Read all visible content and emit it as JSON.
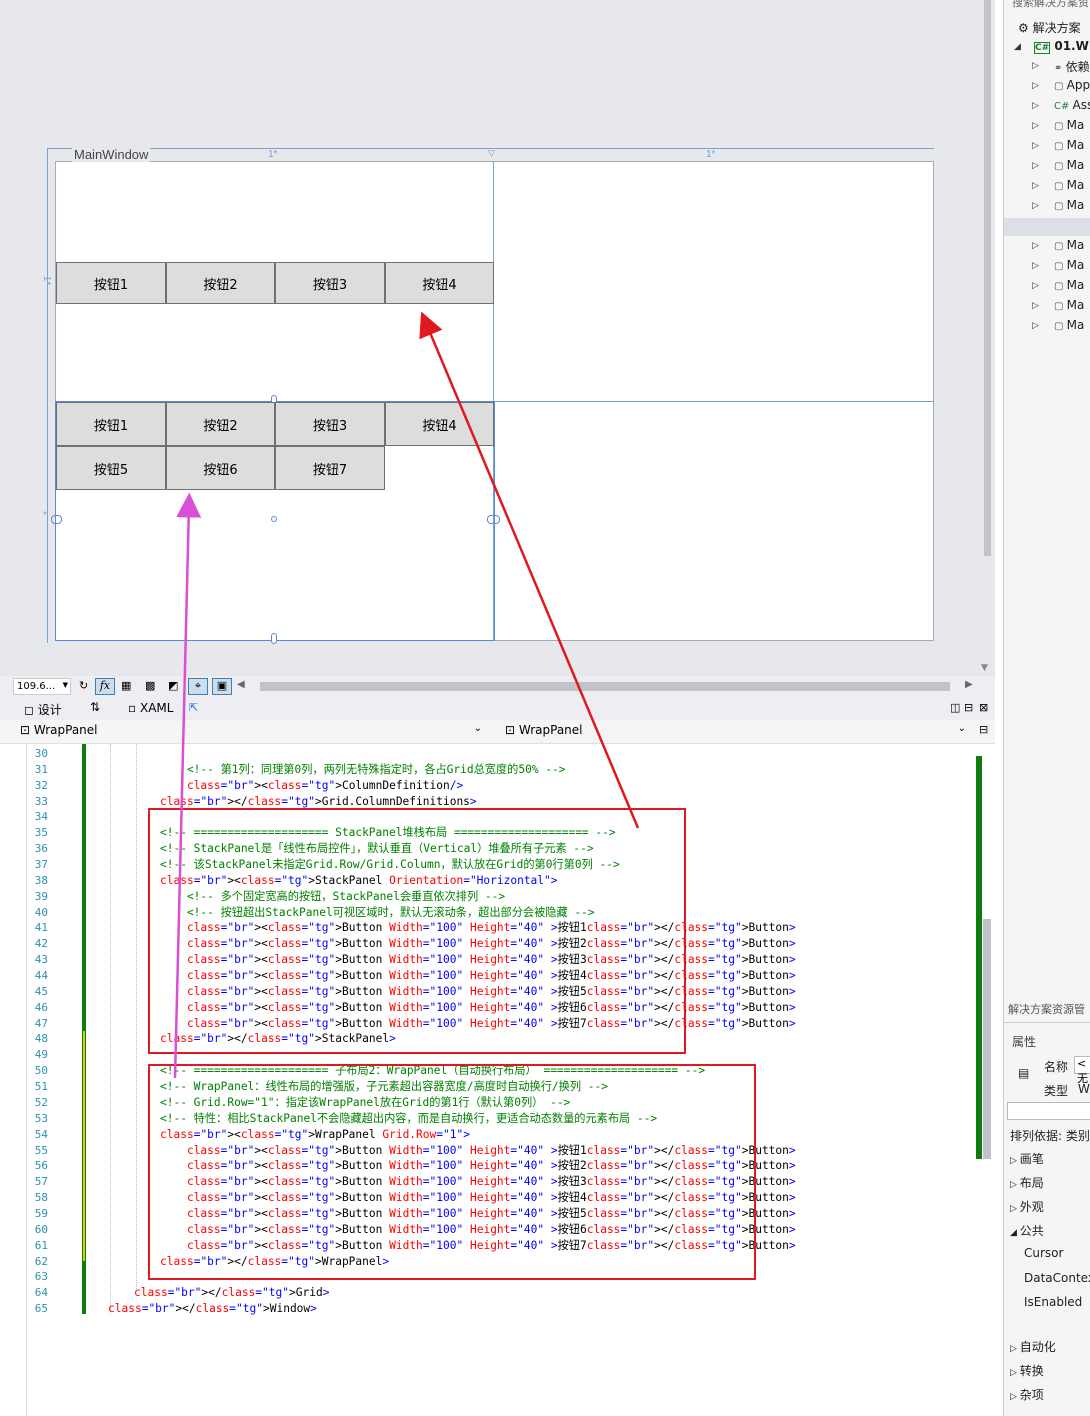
{
  "designer": {
    "window_title": "MainWindow",
    "col_header_1": "1*",
    "col_header_2": "1*",
    "row_header": "1*",
    "row_header_2": "*",
    "stack_buttons": [
      "按钮1",
      "按钮2",
      "按钮3",
      "按钮4"
    ],
    "wrap_buttons": [
      "按钮1",
      "按钮2",
      "按钮3",
      "按钮4",
      "按钮5",
      "按钮6",
      "按钮7"
    ]
  },
  "toolbar": {
    "zoom": "109.6...",
    "fx": "fx"
  },
  "tabs": {
    "design": "设计",
    "swap": "⇅",
    "xaml": "XAML"
  },
  "pathbar": {
    "left": "WrapPanel",
    "right": "WrapPanel"
  },
  "code": {
    "line_numbers": [
      "30",
      "31",
      "32",
      "33",
      "34",
      "35",
      "36",
      "37",
      "38",
      "39",
      "40",
      "41",
      "42",
      "43",
      "44",
      "45",
      "46",
      "47",
      "48",
      "49",
      "50",
      "51",
      "52",
      "53",
      "54",
      "55",
      "56",
      "57",
      "58",
      "59",
      "60",
      "61",
      "62",
      "63",
      "64",
      "65"
    ],
    "lines": [
      "",
      "    <!-- 第1列：同理第0列，两列无特殊指定时，各占Grid总宽度的50% -->",
      "    <ColumnDefinition/>",
      "</Grid.ColumnDefinitions>",
      "",
      "<!-- ==================== StackPanel堆栈布局 ==================== -->",
      "<!-- StackPanel是「线性布局控件」，默认垂直（Vertical）堆叠所有子元素 -->",
      "<!-- 该StackPanel未指定Grid.Row/Grid.Column，默认放在Grid的第0行第0列 -->",
      "<StackPanel Orientation=\"Horizontal\">",
      "    <!-- 多个固定宽高的按钮，StackPanel会垂直依次排列 -->",
      "    <!-- 按钮超出StackPanel可视区域时，默认无滚动条，超出部分会被隐藏 -->",
      "    <Button Width=\"100\" Height=\"40\" >按钮1</Button>",
      "    <Button Width=\"100\" Height=\"40\" >按钮2</Button>",
      "    <Button Width=\"100\" Height=\"40\" >按钮3</Button>",
      "    <Button Width=\"100\" Height=\"40\" >按钮4</Button>",
      "    <Button Width=\"100\" Height=\"40\" >按钮5</Button>",
      "    <Button Width=\"100\" Height=\"40\" >按钮6</Button>",
      "    <Button Width=\"100\" Height=\"40\" >按钮7</Button>",
      "</StackPanel>",
      "",
      "<!-- ==================== 子布局2：WrapPanel（自动换行布局） ==================== -->",
      "<!-- WrapPanel：线性布局的增强版，子元素超出容器宽度/高度时自动换行/换列 -->",
      "<!-- Grid.Row=\"1\"：指定该WrapPanel放在Grid的第1行（默认第0列） -->",
      "<!-- 特性：相比StackPanel不会隐藏超出内容，而是自动换行，更适合动态数量的元素布局 -->",
      "<WrapPanel Grid.Row=\"1\">",
      "    <Button Width=\"100\" Height=\"40\" >按钮1</Button>",
      "    <Button Width=\"100\" Height=\"40\" >按钮2</Button>",
      "    <Button Width=\"100\" Height=\"40\" >按钮3</Button>",
      "    <Button Width=\"100\" Height=\"40\" >按钮4</Button>",
      "    <Button Width=\"100\" Height=\"40\" >按钮5</Button>",
      "    <Button Width=\"100\" Height=\"40\" >按钮6</Button>",
      "    <Button Width=\"100\" Height=\"40\" >按钮7</Button>",
      "</WrapPanel>",
      "",
      "</Grid>",
      "</Window>"
    ]
  },
  "solution_explorer": {
    "search_hint": "搜索解决方案资",
    "solution": "解决方案",
    "project": "01.WF",
    "items": [
      "依赖",
      "App",
      "Ass",
      "Ma",
      "Ma",
      "Ma",
      "Ma",
      "Ma",
      "Ma",
      "Ma",
      "Ma",
      "Ma",
      "Ma",
      "Ma"
    ],
    "footer": "解决方案资源管"
  },
  "properties": {
    "header": "属性",
    "name_label": "名称",
    "name_value": "<无",
    "type_label": "类型",
    "type_value": "W",
    "sort": "排列依据: 类别",
    "categories": [
      "画笔",
      "布局",
      "外观",
      "公共"
    ],
    "common_props": [
      "Cursor",
      "DataContext",
      "IsEnabled"
    ],
    "more_categories": [
      "自动化",
      "转换",
      "杂项"
    ]
  },
  "colors": {
    "accent": "#1e6fd9",
    "annotation_red": "#e0191f",
    "annotation_pink": "#d94fd6"
  }
}
